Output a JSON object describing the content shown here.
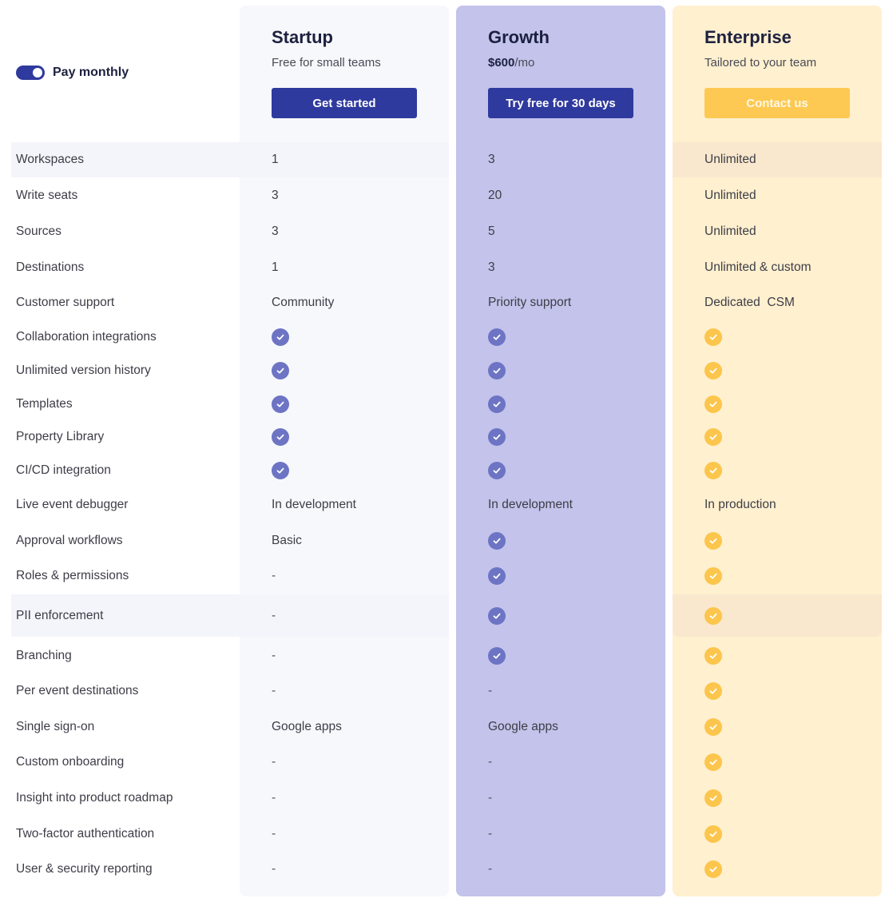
{
  "toggle": {
    "label": "Pay monthly",
    "on": true
  },
  "colors": {
    "accent_blue": "#2f3a9e",
    "accent_yellow": "#fdc952",
    "growth_bg": "#c3c3eb",
    "enterprise_bg": "#fff0cf"
  },
  "plans": [
    {
      "name": "Startup",
      "subtitle": "Free for small teams",
      "price": "",
      "price_unit": "",
      "button": "Get started"
    },
    {
      "name": "Growth",
      "subtitle": "",
      "price": "$600",
      "price_unit": "/mo",
      "button": "Try free for 30 days"
    },
    {
      "name": "Enterprise",
      "subtitle": "Tailored to your team",
      "price": "",
      "price_unit": "",
      "button": "Contact us"
    }
  ],
  "features": [
    {
      "name": "Workspaces",
      "values": [
        "1",
        "3",
        "Unlimited"
      ]
    },
    {
      "name": "Write seats",
      "values": [
        "3",
        "20",
        "Unlimited"
      ]
    },
    {
      "name": "Sources",
      "values": [
        "3",
        "5",
        "Unlimited"
      ]
    },
    {
      "name": "Destinations",
      "values": [
        "1",
        "3",
        "Unlimited & custom"
      ]
    },
    {
      "name": "Customer support",
      "values": [
        "Community",
        "Priority support",
        "Dedicated  CSM"
      ]
    },
    {
      "name": "Collaboration integrations",
      "values": [
        "check",
        "check",
        "check"
      ]
    },
    {
      "name": "Unlimited version history",
      "values": [
        "check",
        "check",
        "check"
      ]
    },
    {
      "name": "Templates",
      "values": [
        "check",
        "check",
        "check"
      ]
    },
    {
      "name": "Property Library",
      "values": [
        "check",
        "check",
        "check"
      ]
    },
    {
      "name": "CI/CD integration",
      "values": [
        "check",
        "check",
        "check"
      ]
    },
    {
      "name": "Live event debugger",
      "values": [
        "In development",
        "In development",
        "In production"
      ]
    },
    {
      "name": "Approval workflows",
      "values": [
        "Basic",
        "check",
        "check"
      ]
    },
    {
      "name": "Roles & permissions",
      "values": [
        "-",
        "check",
        "check"
      ]
    },
    {
      "name": "PII enforcement",
      "values": [
        "-",
        "check",
        "check"
      ]
    },
    {
      "name": "Branching",
      "values": [
        "-",
        "check",
        "check"
      ]
    },
    {
      "name": "Per event destinations",
      "values": [
        "-",
        "-",
        "check"
      ]
    },
    {
      "name": "Single sign-on",
      "values": [
        "Google apps",
        "Google apps",
        "check"
      ]
    },
    {
      "name": "Custom onboarding",
      "values": [
        "-",
        "-",
        "check"
      ]
    },
    {
      "name": "Insight into product roadmap",
      "values": [
        "-",
        "-",
        "check"
      ]
    },
    {
      "name": "Two-factor authentication",
      "values": [
        "-",
        "-",
        "check"
      ]
    },
    {
      "name": "User & security reporting",
      "values": [
        "-",
        "-",
        "check"
      ]
    }
  ]
}
